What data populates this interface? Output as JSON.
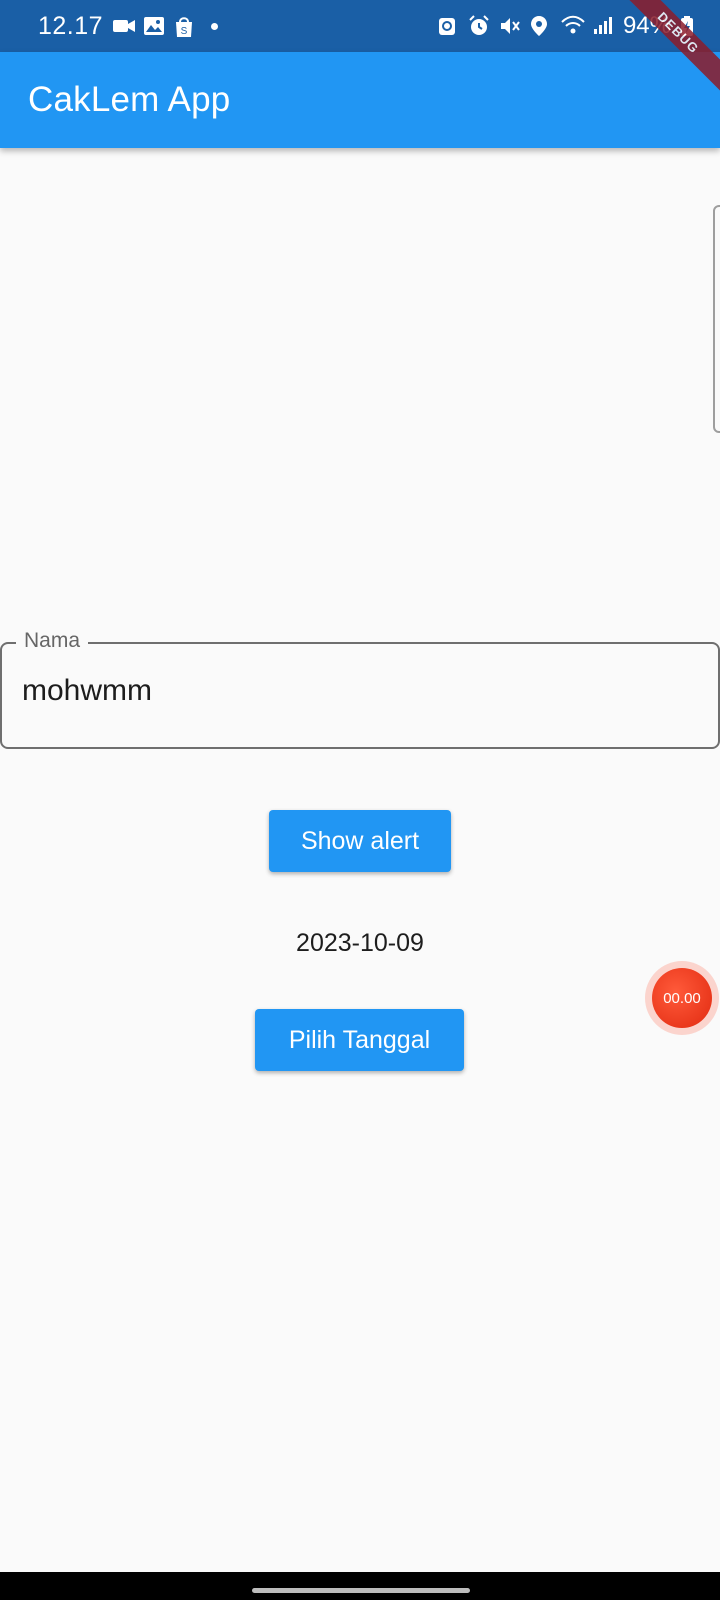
{
  "status_bar": {
    "time": "12.17",
    "battery": "94%",
    "left_icons": [
      "video-camera-icon",
      "image-icon",
      "shopping-bag-icon"
    ],
    "right_icons": [
      "sync-icon",
      "alarm-icon",
      "mute-icon",
      "location-icon",
      "wifi-icon",
      "signal-icon",
      "battery-charging-icon"
    ]
  },
  "debug_banner": {
    "label": "DEBUG"
  },
  "app_bar": {
    "title": "CakLem App",
    "color": "#2196f3"
  },
  "form": {
    "name_field": {
      "label": "Nama",
      "value": "mohwmm"
    }
  },
  "buttons": {
    "show_alert": "Show alert",
    "pick_date": "Pilih Tanggal"
  },
  "selected_date": "2023-10-09",
  "floating_recorder": {
    "timer": "00.00"
  }
}
